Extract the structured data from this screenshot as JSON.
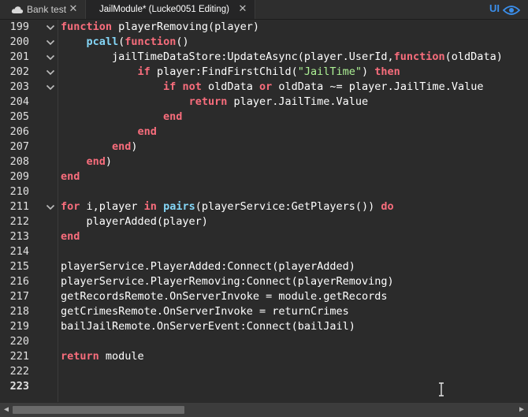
{
  "tabs": [
    {
      "label": "Bank test",
      "active": false
    },
    {
      "label": "JailModule* (Lucke0051 Editing)",
      "active": true
    }
  ],
  "toolbar": {
    "ui_label": "UI"
  },
  "colors": {
    "keyword": "#f86d7c",
    "builtin": "#84d6f7",
    "string": "#adf195",
    "text": "#ffffff",
    "background": "#2b2b2b"
  },
  "editor": {
    "line_numbers": [
      "199",
      "200",
      "201",
      "202",
      "203",
      "204",
      "205",
      "206",
      "207",
      "208",
      "209",
      "210",
      "211",
      "212",
      "213",
      "214",
      "215",
      "216",
      "217",
      "218",
      "219",
      "220",
      "221",
      "222",
      "223"
    ],
    "current_line": "223",
    "fold_markers_at": [
      "199",
      "200",
      "201",
      "202",
      "203",
      "211"
    ],
    "lines": [
      [
        [
          "kw",
          "function"
        ],
        [
          "t",
          " playerRemoving(player)"
        ]
      ],
      [
        [
          "t",
          "    "
        ],
        [
          "fn",
          "pcall"
        ],
        [
          "t",
          "("
        ],
        [
          "kw",
          "function"
        ],
        [
          "t",
          "()"
        ]
      ],
      [
        [
          "t",
          "        jailTimeDataStore:UpdateAsync(player.UserId,"
        ],
        [
          "kw",
          "function"
        ],
        [
          "t",
          "(oldData)"
        ]
      ],
      [
        [
          "t",
          "            "
        ],
        [
          "kw",
          "if"
        ],
        [
          "t",
          " player:FindFirstChild("
        ],
        [
          "str",
          "\"JailTime\""
        ],
        [
          "t",
          ") "
        ],
        [
          "kw",
          "then"
        ]
      ],
      [
        [
          "t",
          "                "
        ],
        [
          "kw",
          "if"
        ],
        [
          "t",
          " "
        ],
        [
          "kw",
          "not"
        ],
        [
          "t",
          " oldData "
        ],
        [
          "kw",
          "or"
        ],
        [
          "t",
          " oldData ~= player.JailTime.Value"
        ]
      ],
      [
        [
          "t",
          "                    "
        ],
        [
          "kw",
          "return"
        ],
        [
          "t",
          " player.JailTime.Value"
        ]
      ],
      [
        [
          "t",
          "                "
        ],
        [
          "kw",
          "end"
        ]
      ],
      [
        [
          "t",
          "            "
        ],
        [
          "kw",
          "end"
        ]
      ],
      [
        [
          "t",
          "        "
        ],
        [
          "kw",
          "end"
        ],
        [
          "t",
          ")"
        ]
      ],
      [
        [
          "t",
          "    "
        ],
        [
          "kw",
          "end"
        ],
        [
          "t",
          ")"
        ]
      ],
      [
        [
          "kw",
          "end"
        ]
      ],
      [],
      [
        [
          "kw",
          "for"
        ],
        [
          "t",
          " i,player "
        ],
        [
          "kw",
          "in"
        ],
        [
          "t",
          " "
        ],
        [
          "fn",
          "pairs"
        ],
        [
          "t",
          "(playerService:GetPlayers()) "
        ],
        [
          "kw",
          "do"
        ]
      ],
      [
        [
          "t",
          "    playerAdded(player)"
        ]
      ],
      [
        [
          "kw",
          "end"
        ]
      ],
      [],
      [
        [
          "t",
          "playerService.PlayerAdded:Connect(playerAdded)"
        ]
      ],
      [
        [
          "t",
          "playerService.PlayerRemoving:Connect(playerRemoving)"
        ]
      ],
      [
        [
          "t",
          "getRecordsRemote.OnServerInvoke = module.getRecords"
        ]
      ],
      [
        [
          "t",
          "getCrimesRemote.OnServerInvoke = returnCrimes"
        ]
      ],
      [
        [
          "t",
          "bailJailRemote.OnServerEvent:Connect(bailJail)"
        ]
      ],
      [],
      [
        [
          "kw",
          "return"
        ],
        [
          "t",
          " module"
        ]
      ],
      [],
      []
    ]
  }
}
